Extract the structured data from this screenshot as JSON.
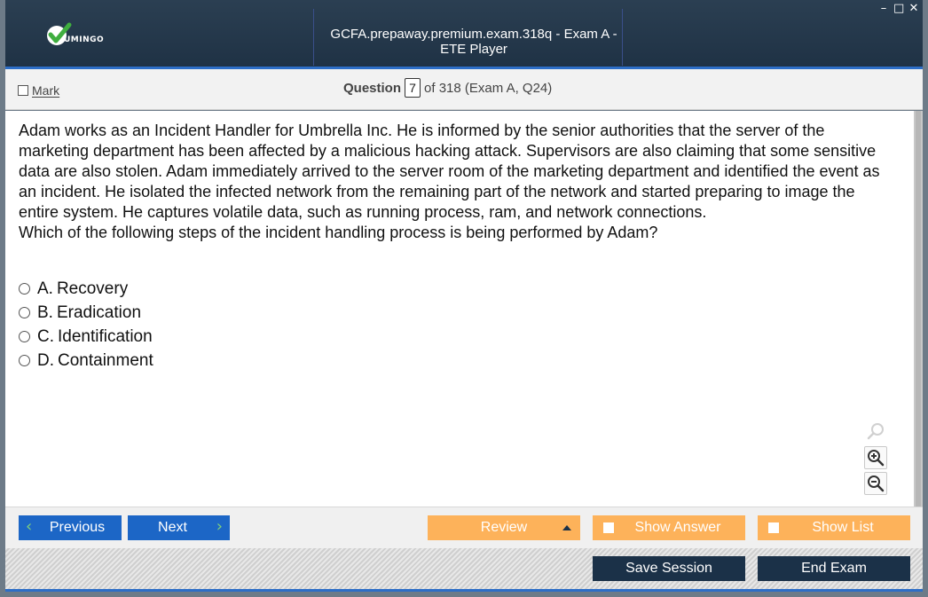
{
  "app": {
    "logo_text": "UMINGO",
    "window_title": "GCFA.prepaway.premium.exam.318q - Exam A - ETE Player",
    "window_controls": [
      "–",
      "□",
      "✕"
    ]
  },
  "question_bar": {
    "mark_label": "Mark",
    "question_label": "Question",
    "question_number": "7",
    "question_total": "of 318 (Exam A, Q24)"
  },
  "question": {
    "stem_lines": [
      "Adam works as an Incident Handler for Umbrella Inc. He is informed by the senior authorities that the server of the marketing department has been affected by a malicious hacking attack. Supervisors are also claiming that some sensitive data are also stolen. Adam immediately arrived to the server room of the marketing department and identified the event as an incident. He isolated the infected network from the remaining part of the network and started preparing to image the entire system. He captures volatile data, such as running process, ram, and network connections.",
      "Which of the following steps of the incident handling process is being performed by Adam?"
    ],
    "options": [
      {
        "letter": "A.",
        "text": "Recovery"
      },
      {
        "letter": "B.",
        "text": "Eradication"
      },
      {
        "letter": "C.",
        "text": "Identification"
      },
      {
        "letter": "D.",
        "text": "Containment"
      }
    ]
  },
  "zoom": {
    "icons": [
      "search-icon",
      "zoom-in-icon",
      "zoom-out-icon"
    ]
  },
  "nav": {
    "previous_label": "Previous",
    "next_label": "Next",
    "review_label": "Review",
    "show_answer_label": "Show Answer",
    "show_list_label": "Show List",
    "save_session_label": "Save Session",
    "end_exam_label": "End Exam"
  },
  "colors": {
    "titlebar": "#1f3245",
    "accent_blue": "#1c66c6",
    "accent_orange": "#fdb25a",
    "dark_button": "#1b3148"
  }
}
